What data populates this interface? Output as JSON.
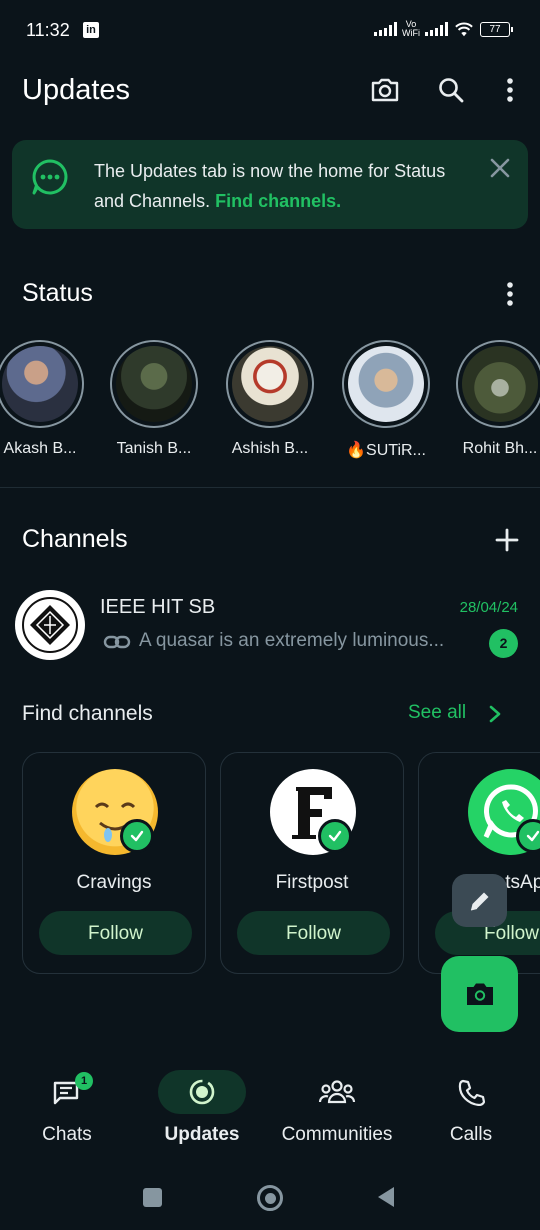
{
  "statusbar": {
    "time": "11:32",
    "carrier_icon": "linkedin-icon",
    "vowifi_top": "Vo",
    "vowifi_bottom": "WiFi",
    "battery": "77"
  },
  "header": {
    "title": "Updates",
    "icons": [
      "camera-icon",
      "search-icon",
      "more-vertical-icon"
    ]
  },
  "banner": {
    "text": "The Updates tab is now the home for Status and Channels. ",
    "link": "Find channels.",
    "icon": "status-icon",
    "colors": {
      "bg": "#103529",
      "accent": "#21c063"
    }
  },
  "status": {
    "title": "Status",
    "items": [
      {
        "name": "Akash B..."
      },
      {
        "name": "Tanish B..."
      },
      {
        "name": "Ashish B..."
      },
      {
        "name": "🔥SUTiR..."
      },
      {
        "name": "Rohit Bh..."
      }
    ]
  },
  "channels": {
    "title": "Channels",
    "list": [
      {
        "name": "IEEE HIT SB",
        "date": "28/04/24",
        "message": "A quasar is an extremely luminous...",
        "unread": "2"
      }
    ]
  },
  "find_channels": {
    "title": "Find channels",
    "see_all": "See all",
    "cards": [
      {
        "name": "Cravings",
        "follow": "Follow"
      },
      {
        "name": "Firstpost",
        "follow": "Follow"
      },
      {
        "name": "WhatsApp",
        "follow": "Follow"
      }
    ]
  },
  "bottom_nav": {
    "items": [
      {
        "label": "Chats",
        "badge": "1"
      },
      {
        "label": "Updates",
        "active": true
      },
      {
        "label": "Communities"
      },
      {
        "label": "Calls"
      }
    ]
  },
  "colors": {
    "background": "#0b141a",
    "accent": "#21c063",
    "muted": "#8696a0"
  }
}
